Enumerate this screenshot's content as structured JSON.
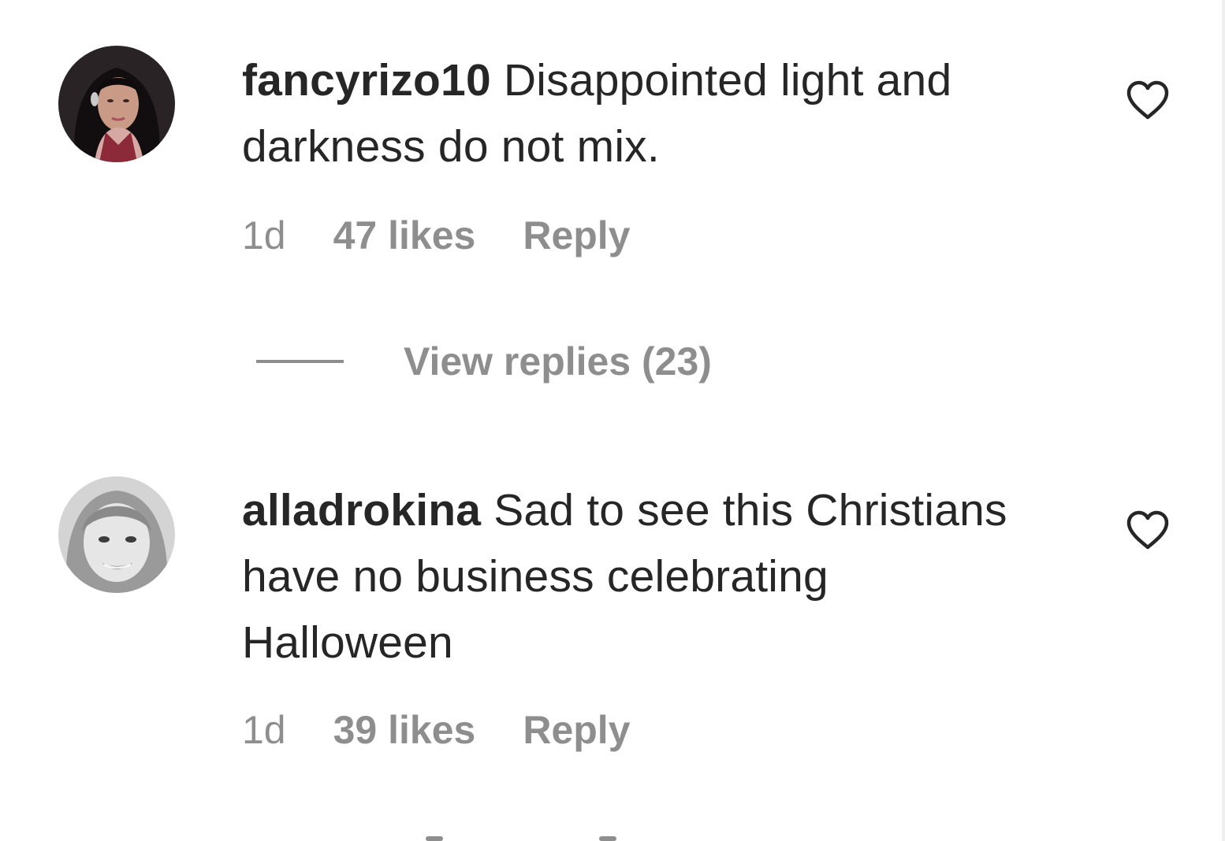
{
  "comments": [
    {
      "username": "fancyrizo10",
      "text": "Disappointed light and darkness do not mix.",
      "time": "1d",
      "likes": "47 likes",
      "reply_label": "Reply",
      "avatar_icon": "profile-photo-woman-dark-hair"
    },
    {
      "username": "alladrokina",
      "text": "Sad to see this Christians have no business celebrating Halloween",
      "time": "1d",
      "likes": "39 likes",
      "reply_label": "Reply",
      "avatar_icon": "profile-photo-woman-grayscale"
    }
  ],
  "view_replies": {
    "label": "View replies (23)"
  },
  "icons": {
    "like": "heart-outline-icon"
  },
  "colors": {
    "text": "#262626",
    "secondary": "#8e8e8e",
    "background": "#ffffff"
  }
}
